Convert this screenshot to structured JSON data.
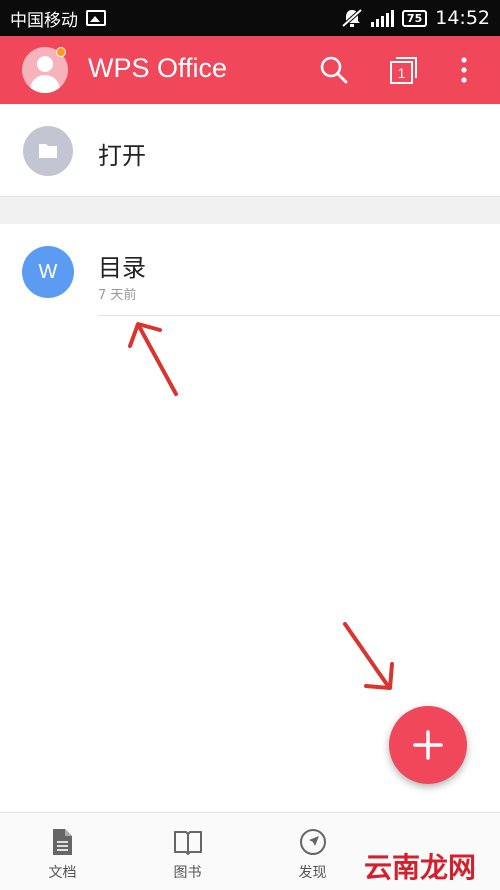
{
  "status_bar": {
    "carrier": "中国移动",
    "battery": "75",
    "time": "14:52"
  },
  "app_bar": {
    "title": "WPS Office",
    "tab_count": "1"
  },
  "open_row": {
    "label": "打开"
  },
  "documents": [
    {
      "icon_letter": "W",
      "title": "目录",
      "time": "7 天前"
    }
  ],
  "bottom_nav": {
    "items": [
      {
        "label": "文档",
        "icon": "document-icon"
      },
      {
        "label": "图书",
        "icon": "book-icon"
      },
      {
        "label": "发现",
        "icon": "compass-icon"
      }
    ]
  },
  "watermark": "云南龙网",
  "colors": {
    "accent": "#f0475b",
    "doc_icon": "#5b9cf2",
    "folder_icon": "#c4c5d3",
    "arrow": "#d9342e"
  }
}
